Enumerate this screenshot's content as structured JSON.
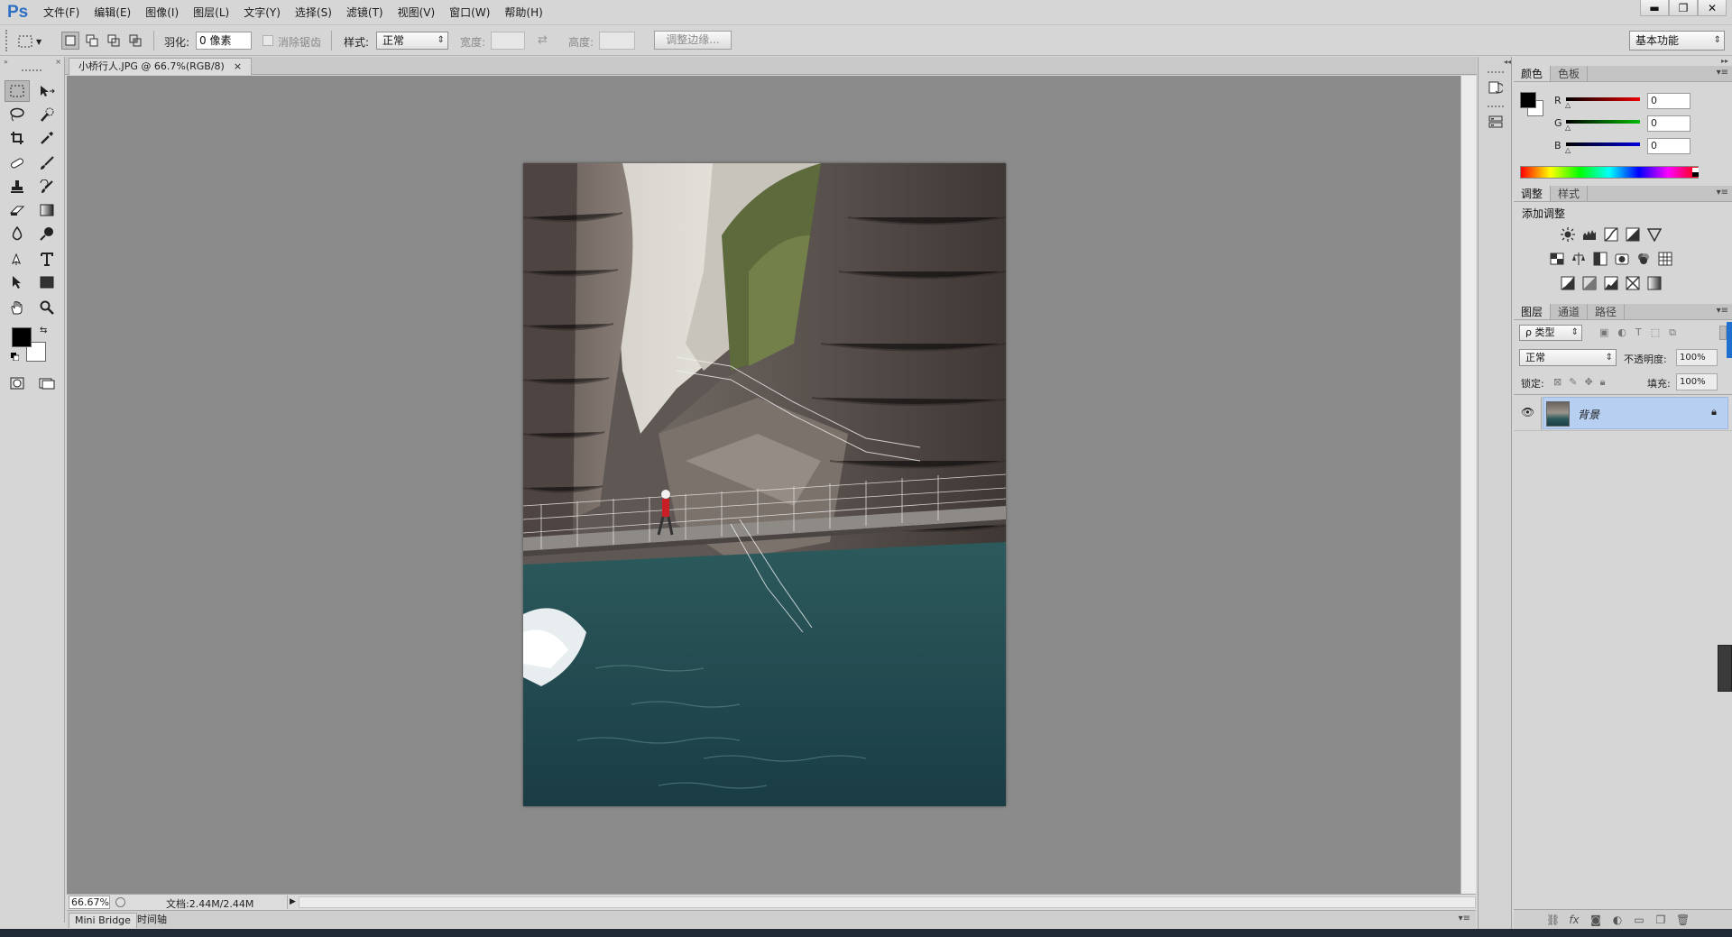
{
  "app": {
    "logo": "Ps"
  },
  "menu": [
    "文件(F)",
    "编辑(E)",
    "图像(I)",
    "图层(L)",
    "文字(Y)",
    "选择(S)",
    "滤镜(T)",
    "视图(V)",
    "窗口(W)",
    "帮助(H)"
  ],
  "window_controls": {
    "minimize": "▬",
    "restore": "❐",
    "close": "✕"
  },
  "options": {
    "feather_label": "羽化:",
    "feather_value": "0 像素",
    "antialias_label": "消除锯齿",
    "style_label": "样式:",
    "style_value": "正常",
    "width_label": "宽度:",
    "height_label": "高度:",
    "refine_edge": "调整边缘...",
    "workspace": "基本功能"
  },
  "document": {
    "tab_title": "小桥行人.JPG @ 66.7%(RGB/8)",
    "tab_close": "×",
    "zoom": "66.67%",
    "doc_size": "文档:2.44M/2.44M"
  },
  "bottom_tabs": [
    "Mini Bridge",
    "时间轴"
  ],
  "color_panel": {
    "tabs": [
      "颜色",
      "色板"
    ],
    "channels": [
      {
        "label": "R",
        "value": "0"
      },
      {
        "label": "G",
        "value": "0"
      },
      {
        "label": "B",
        "value": "0"
      }
    ],
    "foreground": "#000000",
    "background": "#ffffff"
  },
  "adjust_panel": {
    "tabs": [
      "调整",
      "样式"
    ],
    "title": "添加调整"
  },
  "layers_panel": {
    "tabs": [
      "图层",
      "通道",
      "路径"
    ],
    "filter_kind": "ρ 类型",
    "blend_mode": "正常",
    "opacity_label": "不透明度:",
    "opacity_value": "100%",
    "lock_label": "锁定:",
    "fill_label": "填充:",
    "fill_value": "100%",
    "layers": [
      {
        "name": "背景",
        "locked": true,
        "visible": true
      }
    ]
  },
  "layer_footer_icons": [
    "link-icon",
    "fx-icon",
    "mask-icon",
    "adjustment-icon",
    "folder-icon",
    "new-layer-icon",
    "trash-icon"
  ]
}
